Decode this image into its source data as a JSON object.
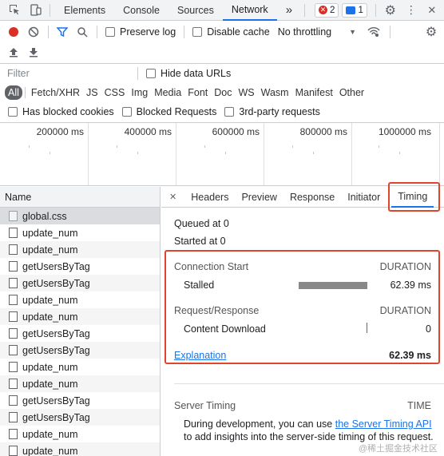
{
  "tabbar": {
    "tabs": [
      "Elements",
      "Console",
      "Sources",
      "Network"
    ],
    "active_tab": "Network",
    "more": "»",
    "errors_count": "2",
    "messages_count": "1"
  },
  "toolbar": {
    "preserve_log": "Preserve log",
    "disable_cache": "Disable cache",
    "throttling": "No throttling"
  },
  "filter": {
    "placeholder": "Filter",
    "hide_data_urls": "Hide data URLs",
    "types": [
      "All",
      "Fetch/XHR",
      "JS",
      "CSS",
      "Img",
      "Media",
      "Font",
      "Doc",
      "WS",
      "Wasm",
      "Manifest",
      "Other"
    ],
    "has_blocked_cookies": "Has blocked cookies",
    "blocked_requests": "Blocked Requests",
    "third_party": "3rd-party requests"
  },
  "overview": {
    "labels": [
      "200000 ms",
      "400000 ms",
      "600000 ms",
      "800000 ms",
      "1000000 ms"
    ]
  },
  "requests": {
    "header": "Name",
    "items": [
      "global.css",
      "update_num",
      "update_num",
      "getUsersByTag",
      "getUsersByTag",
      "update_num",
      "update_num",
      "getUsersByTag",
      "getUsersByTag",
      "update_num",
      "update_num",
      "getUsersByTag",
      "getUsersByTag",
      "update_num",
      "update_num"
    ]
  },
  "details": {
    "close": "✕",
    "tabs": [
      "Headers",
      "Preview",
      "Response",
      "Initiator",
      "Timing"
    ],
    "active_tab": "Timing",
    "queued": "Queued at 0",
    "started": "Started at 0",
    "connection_start": "Connection Start",
    "duration": "DURATION",
    "stalled": "Stalled",
    "stalled_value": "62.39 ms",
    "request_response": "Request/Response",
    "duration2": "DURATION",
    "content_download": "Content Download",
    "content_download_value": "0",
    "explanation": "Explanation",
    "total": "62.39 ms",
    "server_timing": "Server Timing",
    "time": "TIME",
    "server_text_1": "During development, you can use",
    "server_link": "the Server Timing API",
    "server_text_2": "to add insights into the server-side timing of this request.",
    "watermark": "@稀土掘金技术社区"
  },
  "colors": {
    "accent": "#1a73e8",
    "record": "#d93025",
    "highlight_box": "#e0442c"
  }
}
